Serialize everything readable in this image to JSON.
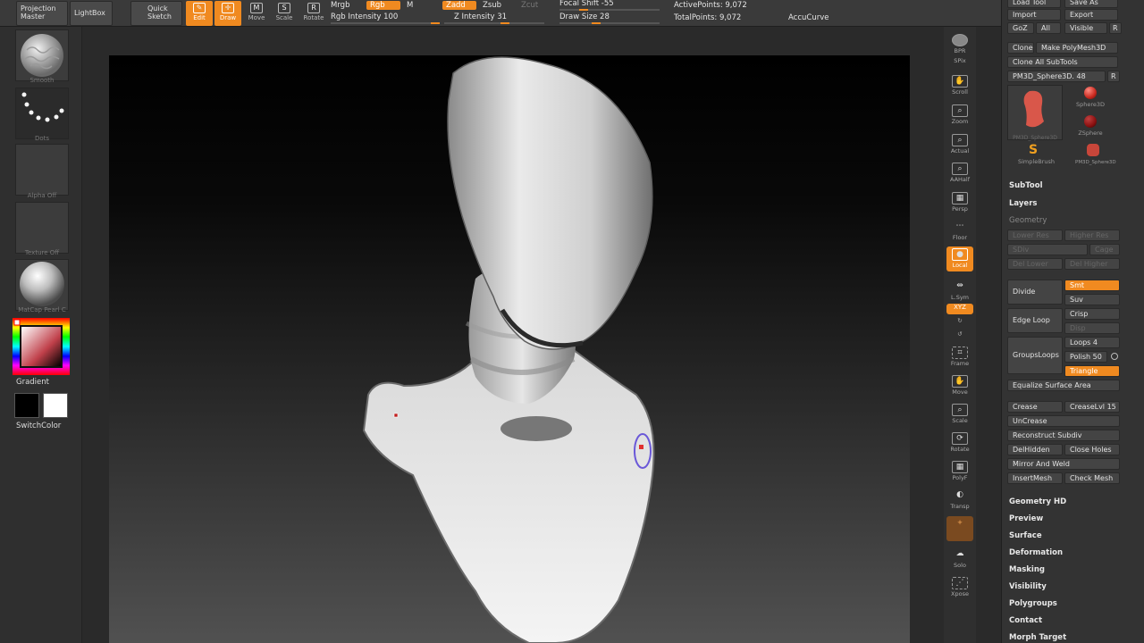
{
  "topbar": {
    "projection_master": "Projection\nMaster",
    "lightbox": "LightBox",
    "quick_sketch": "Quick\nSketch",
    "edit": "Edit",
    "draw": "Draw",
    "move": "Move",
    "scale": "Scale",
    "rotate": "Rotate",
    "mrgb": "Mrgb",
    "rgb": "Rgb",
    "m": "M",
    "rgb_intensity": "Rgb Intensity 100",
    "zadd": "Zadd",
    "zsub": "Zsub",
    "zcut": "Zcut",
    "z_intensity": "Z Intensity 31",
    "focal_shift": "Focal Shift -55",
    "draw_size": "Draw Size 28",
    "active_points": "ActivePoints: 9,072",
    "total_points": "TotalPoints: 9,072",
    "accucurve": "AccuCurve",
    "rgb_intensity_value": 100,
    "z_intensity_value": 31,
    "focal_shift_value": -55,
    "draw_size_value": 28
  },
  "left": {
    "brush": "Smooth",
    "stroke": "Dots",
    "alpha": "Alpha Off",
    "texture": "Texture Off",
    "material": "MatCap Pearl C",
    "gradient": "Gradient",
    "switch_color": "SwitchColor"
  },
  "rightshelf": {
    "bpr": "BPR",
    "spix": "SPix",
    "scroll": "Scroll",
    "zoom": "Zoom",
    "actual": "Actual",
    "aahalf": "AAHalf",
    "persp": "Persp",
    "floor": "Floor",
    "local": "Local",
    "lsym": "L.Sym",
    "xyz": "XYZ",
    "frame": "Frame",
    "move": "Move",
    "scale": "Scale",
    "rotate": "Rotate",
    "polyf": "PolyF",
    "transp": "Transp",
    "solo": "Solo",
    "xpose": "Xpose"
  },
  "panel": {
    "load_tool": "Load Tool",
    "save_as": "Save As",
    "import": "Import",
    "export": "Export",
    "goz": "GoZ",
    "all": "All",
    "visible": "Visible",
    "r": "R",
    "clone": "Clone",
    "make_polymesh": "Make PolyMesh3D",
    "clone_all": "Clone All SubTools",
    "current_tool": "PM3D_Sphere3D. 48",
    "tools": [
      {
        "name": "PM3D_Sphere3D",
        "color": "#c8463a"
      },
      {
        "name": "Sphere3D",
        "color": "#c8281e"
      },
      {
        "name": "ZSphere",
        "color": "#8a1010"
      },
      {
        "name": "SimpleBrush",
        "color": "#f0a020"
      },
      {
        "name": "PM3D_Sphere3D",
        "color": "#c8463a"
      }
    ],
    "subtool": "SubTool",
    "layers": "Layers",
    "geometry": "Geometry",
    "lower_res": "Lower Res",
    "higher_res": "Higher Res",
    "sdiv": "SDiv",
    "cage": "Cage",
    "del_lower": "Del Lower",
    "del_higher": "Del Higher",
    "divide": "Divide",
    "smt": "Smt",
    "suv": "Suv",
    "edge_loop": "Edge Loop",
    "crisp": "Crisp",
    "disp": "Disp",
    "groups_loops": "GroupsLoops",
    "loops": "Loops 4",
    "polish": "Polish 50",
    "triangle": "Triangle",
    "equalize": "Equalize Surface Area",
    "crease": "Crease",
    "crease_lvl": "CreaseLvl 15",
    "uncrease": "UnCrease",
    "reconstruct": "Reconstruct Subdiv",
    "delhidden": "DelHidden",
    "close_holes": "Close Holes",
    "mirror_weld": "Mirror And Weld",
    "insertmesh": "InsertMesh",
    "check_mesh": "Check Mesh",
    "geometry_hd": "Geometry HD",
    "preview": "Preview",
    "surface": "Surface",
    "deformation": "Deformation",
    "masking": "Masking",
    "visibility": "Visibility",
    "polygroups": "Polygroups",
    "contact": "Contact",
    "morph_target": "Morph Target"
  },
  "colors": {
    "accent": "#f08a20",
    "panel": "#333333",
    "background": "#2a2a2a"
  }
}
